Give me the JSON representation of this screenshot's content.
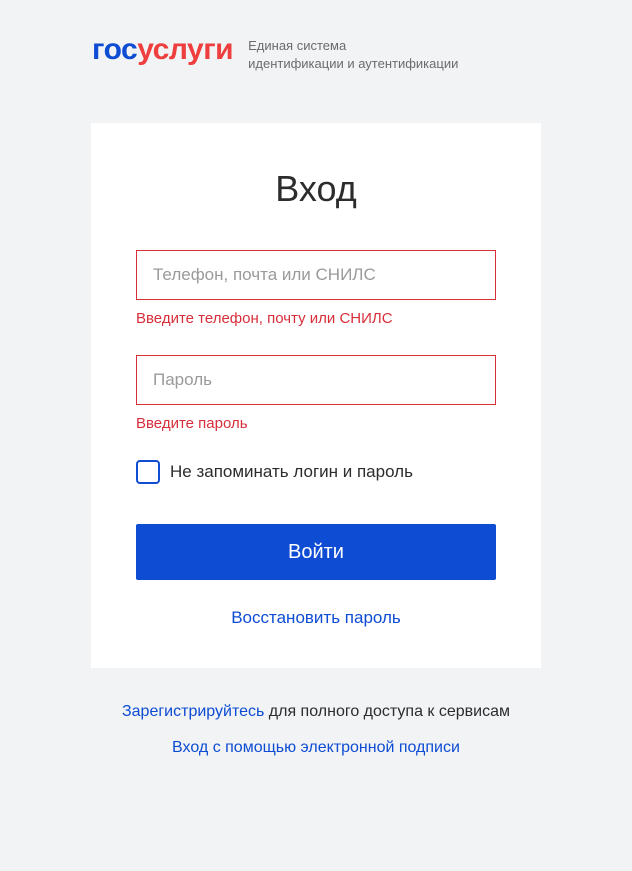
{
  "header": {
    "logo_part1": "гос",
    "logo_part2": "услуги",
    "subtitle_line1": "Единая система",
    "subtitle_line2": "идентификации и аутентификации"
  },
  "form": {
    "title": "Вход",
    "login": {
      "placeholder": "Телефон, почта или СНИЛС",
      "error": "Введите телефон, почту или СНИЛС"
    },
    "password": {
      "placeholder": "Пароль",
      "error": "Введите пароль"
    },
    "remember_label": "Не запоминать логин и пароль",
    "submit_label": "Войти",
    "restore_label": "Восстановить пароль"
  },
  "footer": {
    "register_link": "Зарегистрируйтесь",
    "register_text": " для полного доступа к сервисам",
    "esign_link": "Вход с помощью электронной подписи"
  }
}
